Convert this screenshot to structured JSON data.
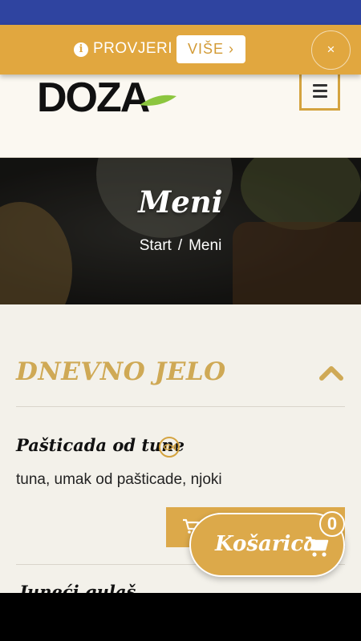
{
  "promo": {
    "text": "PROVJERI",
    "more_label": "VIŠE ›",
    "close_label": "×",
    "info_glyph": "i"
  },
  "header": {
    "logo_text": "DOZA",
    "menu_icon": "hamburger-icon"
  },
  "hero": {
    "title": "Meni",
    "breadcrumb": {
      "home": "Start",
      "separator": "/",
      "current": "Meni"
    }
  },
  "section": {
    "title": "DNEVNO JELO",
    "toggle_icon": "chevron-up-icon"
  },
  "dishes": [
    {
      "name": "Pašticada od tune",
      "description": "tuna, umak od pašticade, njoki",
      "tag_icon": "fish-icon"
    },
    {
      "name": "Junеći gulaš"
    }
  ],
  "cart": {
    "label": "Košarica",
    "count": "0"
  },
  "colors": {
    "accent": "#dca94a",
    "promo": "#e1a73f",
    "section_title": "#cfa955",
    "status_bar": "#2f44a0"
  }
}
